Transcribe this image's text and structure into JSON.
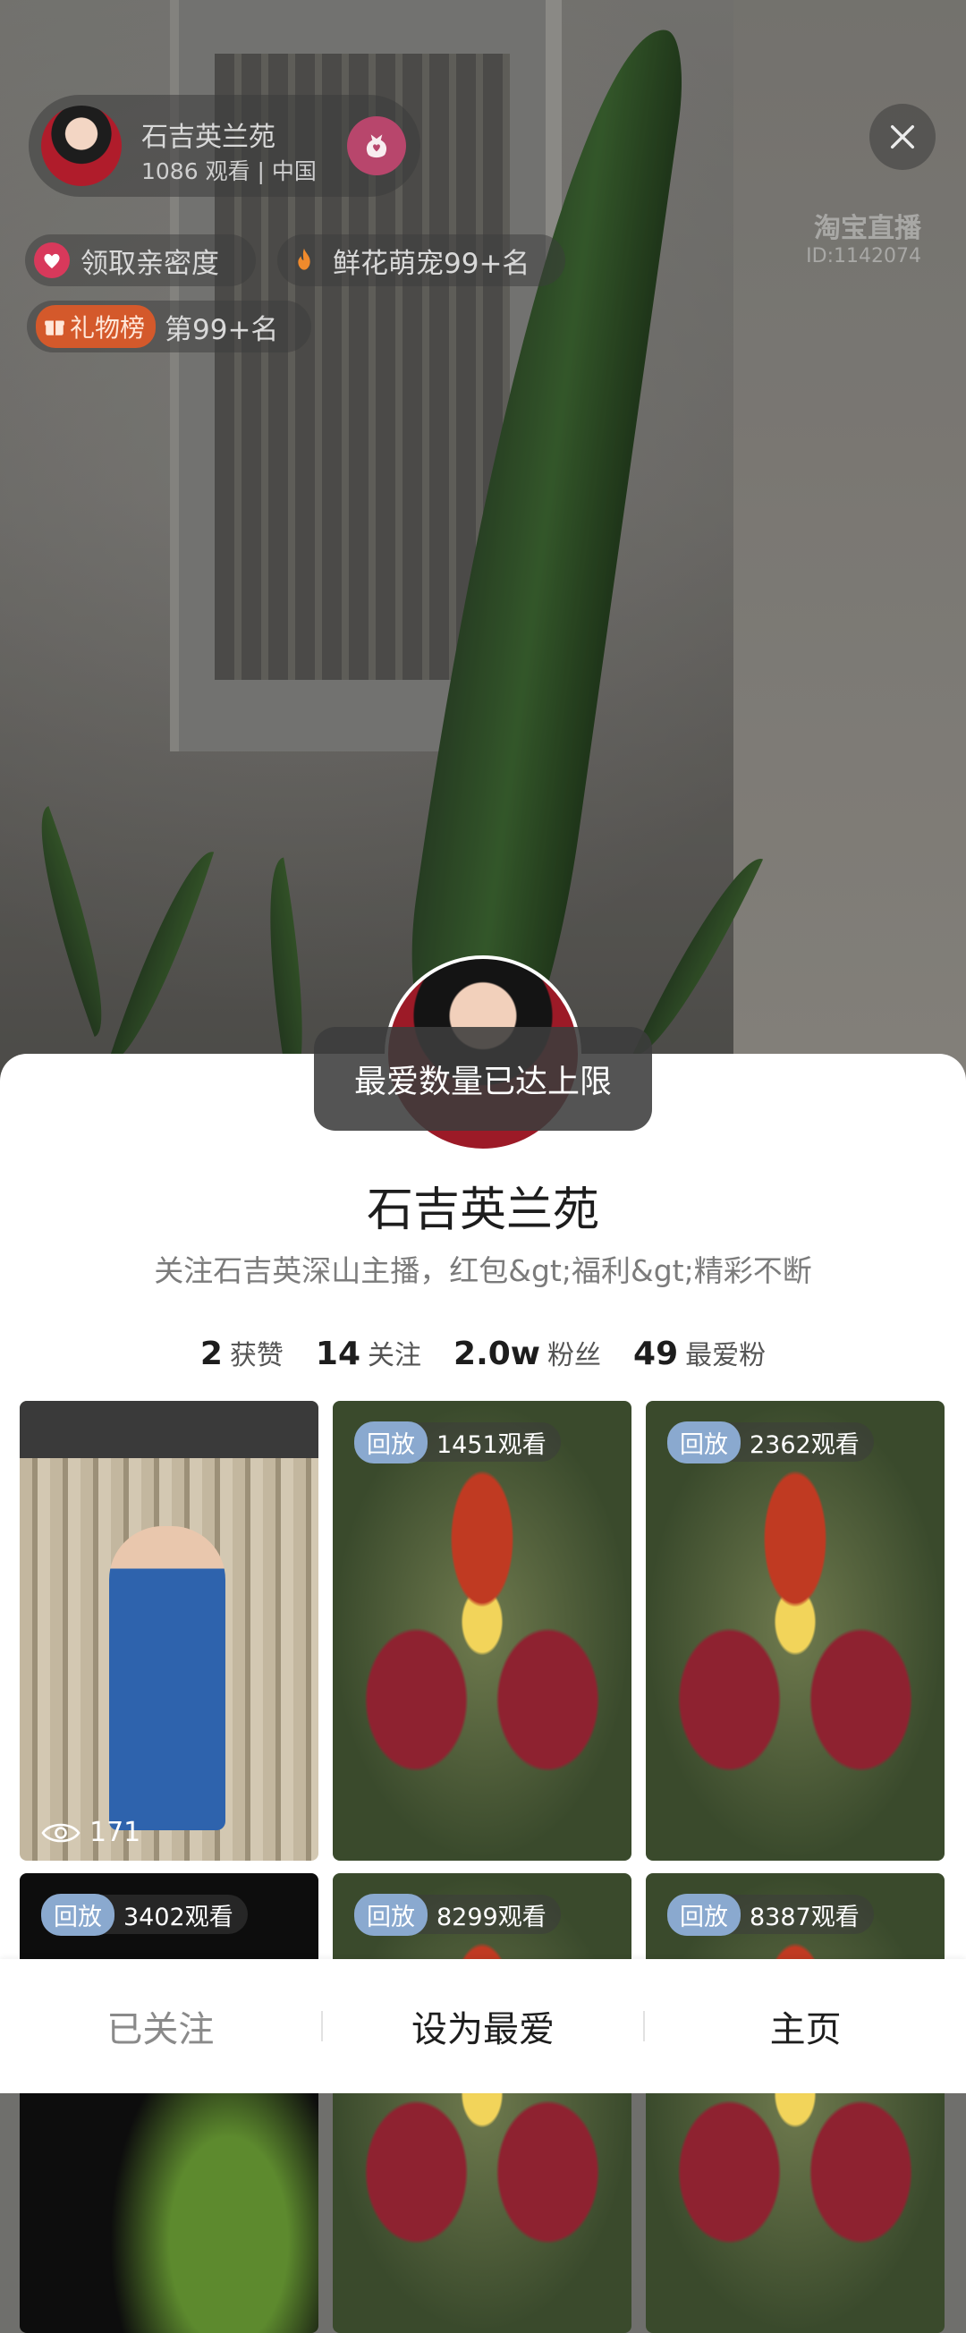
{
  "host": {
    "name": "石吉英兰苑",
    "viewers": "1086 观看",
    "separator": "|",
    "location": "中国"
  },
  "watermark": {
    "brand": "淘宝直播",
    "id": "ID:1142074"
  },
  "chips": {
    "intimacy": "领取亲密度",
    "ranking": "鲜花萌宠99+名",
    "gift_tag": "礼物榜",
    "gift_rank": "第99+名"
  },
  "toast": "最爱数量已达上限",
  "profile": {
    "name": "石吉英兰苑",
    "bio": "关注石吉英深山主播，红包&gt;福利&gt;精彩不断",
    "stats": [
      {
        "num": "2",
        "label": "获赞"
      },
      {
        "num": "14",
        "label": "关注"
      },
      {
        "num": "2.0w",
        "label": "粉丝"
      },
      {
        "num": "49",
        "label": "最爱粉"
      }
    ]
  },
  "videos": [
    {
      "type": "video",
      "views": "171"
    },
    {
      "type": "replay",
      "tag": "回放",
      "views": "1451观看"
    },
    {
      "type": "replay",
      "tag": "回放",
      "views": "2362观看"
    },
    {
      "type": "replay",
      "tag": "回放",
      "views": "3402观看"
    },
    {
      "type": "replay",
      "tag": "回放",
      "views": "8299观看"
    },
    {
      "type": "replay",
      "tag": "回放",
      "views": "8387观看"
    }
  ],
  "actions": {
    "followed": "已关注",
    "set_favorite": "设为最爱",
    "homepage": "主页"
  },
  "colors": {
    "fav_button": "#b8466c",
    "replay_tag": "#8aa9cf",
    "gift_tag": "#d4592b"
  }
}
